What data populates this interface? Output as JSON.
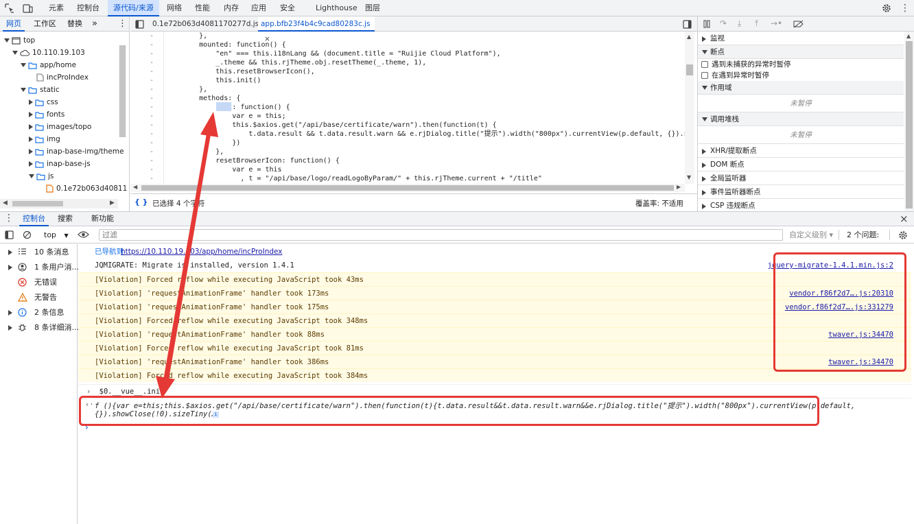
{
  "top_tabs": [
    {
      "label": "元素"
    },
    {
      "label": "控制台"
    },
    {
      "label": "源代码/来源",
      "active": true
    },
    {
      "label": "网络"
    },
    {
      "label": "性能"
    },
    {
      "label": "内存"
    },
    {
      "label": "应用"
    },
    {
      "label": "安全"
    },
    {
      "label": "Lighthouse"
    },
    {
      "label": "图层"
    }
  ],
  "navigator": {
    "tabs": [
      "网页",
      "工作区",
      "替换"
    ],
    "more": "»",
    "tree": [
      {
        "label": "top",
        "depth": 0,
        "icon": "frame-icon",
        "open": true
      },
      {
        "label": "10.110.19.103",
        "depth": 1,
        "icon": "cloud-icon",
        "open": true
      },
      {
        "label": "app/home",
        "depth": 2,
        "icon": "folder-icon",
        "open": true
      },
      {
        "label": "incProIndex",
        "depth": 3,
        "icon": "file-icon"
      },
      {
        "label": "static",
        "depth": 2,
        "icon": "folder-icon",
        "open": true
      },
      {
        "label": "css",
        "depth": 3,
        "icon": "folder-icon",
        "open": false
      },
      {
        "label": "fonts",
        "depth": 3,
        "icon": "folder-icon",
        "open": false
      },
      {
        "label": "images/topo",
        "depth": 3,
        "icon": "folder-icon",
        "open": false
      },
      {
        "label": "img",
        "depth": 3,
        "icon": "folder-icon",
        "open": false
      },
      {
        "label": "inap-base-img/theme",
        "depth": 3,
        "icon": "folder-icon",
        "open": false
      },
      {
        "label": "inap-base-js",
        "depth": 3,
        "icon": "folder-icon",
        "open": false
      },
      {
        "label": "js",
        "depth": 3,
        "icon": "folder-icon",
        "open": true
      },
      {
        "label": "0.1e72b063d40811",
        "depth": 4,
        "icon": "js-file-icon"
      }
    ]
  },
  "editor": {
    "tabs": [
      {
        "label": "0.1e72b063d4081170277d.js",
        "active": false
      },
      {
        "label": "app.bfb23f4b4c9cad80283c.js",
        "active": true,
        "close": "×"
      }
    ],
    "lines": [
      {
        "gutter": "-",
        "text": "        },"
      },
      {
        "gutter": "-",
        "text": "        mounted: function() {"
      },
      {
        "gutter": "-",
        "text": "            \"en\" === this.i18nLang && (document.title = \"Ruijie Cloud Platform\"),"
      },
      {
        "gutter": "-",
        "text": "            _.theme && this.rjTheme.obj.resetTheme(_.theme, 1),"
      },
      {
        "gutter": "-",
        "text": "            this.resetBrowserIcon(),"
      },
      {
        "gutter": "-",
        "text": "            this.init()"
      },
      {
        "gutter": "-",
        "text": "        },"
      },
      {
        "gutter": "-",
        "text": "        methods: {"
      },
      {
        "gutter": "-",
        "text": "            init: function() {"
      },
      {
        "gutter": "-",
        "text": "                var e = this;"
      },
      {
        "gutter": "-",
        "text": "                this.$axios.get(\"/api/base/certificate/warn\").then(function(t) {"
      },
      {
        "gutter": "-",
        "text": "                    t.data.result && t.data.result.warn && e.rjDialog.title(\"提示\").width(\"800px\").currentView(p.default, {}).sh"
      },
      {
        "gutter": "-",
        "text": "                })"
      },
      {
        "gutter": "-",
        "text": "            },"
      },
      {
        "gutter": "-",
        "text": "            resetBrowserIcon: function() {"
      },
      {
        "gutter": "-",
        "text": "                var e = this"
      },
      {
        "gutter": "-",
        "text": "                  , t = \"/api/base/logo/readLogoByParam/\" + this.rjTheme.current + \"/title\""
      }
    ],
    "status_left": "已选择 4 个字符",
    "status_right": "覆盖率: 不适用"
  },
  "debugger": {
    "sections": [
      {
        "label": "监视",
        "open": false
      },
      {
        "label": "断点",
        "open": true
      },
      {
        "label": "遇到未捕获的异常时暂停",
        "checkbox": true
      },
      {
        "label": "在遇到异常时暂停",
        "checkbox": true
      },
      {
        "label": "作用域",
        "open": true
      },
      {
        "label": "未暂停",
        "placeholder": true
      },
      {
        "label": "调用堆栈",
        "open": true
      },
      {
        "label": "未暂停",
        "placeholder": true
      },
      {
        "label": "XHR/提取断点",
        "open": false
      },
      {
        "label": "DOM 断点",
        "open": false
      },
      {
        "label": "全局监听器",
        "open": false
      },
      {
        "label": "事件监听器断点",
        "open": false
      },
      {
        "label": "CSP 违规断点",
        "open": false
      }
    ]
  },
  "drawer": {
    "tabs": [
      "控制台",
      "搜索",
      "新功能"
    ],
    "active": "控制台",
    "close": "×"
  },
  "console_toolbar": {
    "context": "top",
    "filter_placeholder": "过滤",
    "levels": "自定义级别 ▾",
    "issues": "2 个问题:"
  },
  "console_sidebar": [
    {
      "label": "10 条消息",
      "icon": "list-icon",
      "expandable": true
    },
    {
      "label": "1 条用户消...",
      "icon": "user-icon",
      "expandable": true
    },
    {
      "label": "无错误",
      "icon": "error-icon",
      "expandable": false
    },
    {
      "label": "无警告",
      "icon": "warning-icon",
      "expandable": false
    },
    {
      "label": "2 条信息",
      "icon": "info-icon",
      "expandable": true
    },
    {
      "label": "8 条详细消...",
      "icon": "bug-icon",
      "expandable": true
    }
  ],
  "console_messages": [
    {
      "kind": "nav",
      "prefix": "已导航到",
      "link": "https://10.110.19.103/app/home/incProIndex",
      "source": ""
    },
    {
      "kind": "log",
      "text": "JQMIGRATE: Migrate is installed, version 1.4.1",
      "source": "jquery-migrate-1.4.1.min.js:2"
    },
    {
      "kind": "violation",
      "text": "[Violation] Forced reflow while executing JavaScript took 43ms",
      "source": ""
    },
    {
      "kind": "violation",
      "text": "[Violation] 'requestAnimationFrame' handler took 173ms",
      "source": "vendor.f86f2d7….js:20310"
    },
    {
      "kind": "violation",
      "text": "[Violation] 'requestAnimationFrame' handler took 175ms",
      "source": "vendor.f86f2d7….js:331279"
    },
    {
      "kind": "violation",
      "text": "[Violation] Forced reflow while executing JavaScript took 348ms",
      "source": ""
    },
    {
      "kind": "violation",
      "text": "[Violation] 'requestAnimationFrame' handler took 88ms",
      "source": "twaver.js:34470"
    },
    {
      "kind": "violation",
      "text": "[Violation] Forced reflow while executing JavaScript took 81ms",
      "source": ""
    },
    {
      "kind": "violation",
      "text": "[Violation] 'requestAnimationFrame' handler took 386ms",
      "source": "twaver.js:34470"
    },
    {
      "kind": "violation",
      "text": "[Violation] Forced reflow while executing JavaScript took 384ms",
      "source": ""
    }
  ],
  "console_input": "$0.__vue__.init",
  "console_result": {
    "line1": "f (){var e=this;this.$axios.get(\"/api/base/certificate/warn\").then(function(t){t.data.result&&t.data.result.warn&&e.rjDialog.title(\"提示\").width(\"800px\").currentView(p.default,",
    "line2": "{}).showClose(!0).sizeTiny(…"
  },
  "colors": {
    "accent": "#0b57d0",
    "annotation_red": "#e53935",
    "violation_bg": "#fffbe5"
  }
}
